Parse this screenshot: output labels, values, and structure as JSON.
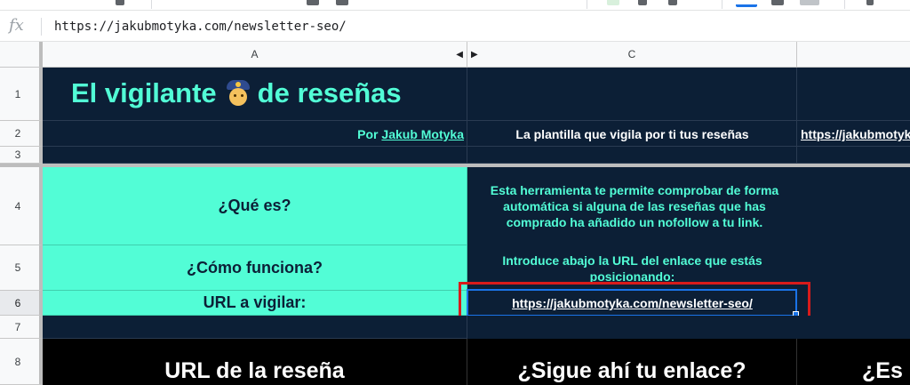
{
  "formula_bar": {
    "fx_label": "fx",
    "value": "https://jakubmotyka.com/newsletter-seo/"
  },
  "columns": {
    "a": "A",
    "c": "C"
  },
  "rows": [
    "1",
    "2",
    "3",
    "4",
    "5",
    "6",
    "7",
    "8"
  ],
  "sheet": {
    "title_left": "El vigilante",
    "title_right": "de reseñas",
    "emoji_icon": "police-officer-icon",
    "by_prefix": "Por",
    "by_author": "Jakub Motyka",
    "tagline": "La plantilla que vigila por ti tus reseñas",
    "row2_link": "https://jakubmotyka.com/newsletter-seo/",
    "q_what": "¿Qué es?",
    "q_how": "¿Cómo funciona?",
    "q_url": "URL a vigilar:",
    "desc_line1": "Esta herramienta te permite comprobar de forma",
    "desc_line2": "automática si alguna de las reseñas que has",
    "desc_line3": "comprado ha añadido un nofollow a tu link.",
    "how_line1": "Introduce abajo la URL del enlace que estás",
    "how_line2": "posicionando:",
    "url_value": "https://jakubmotyka.com/newsletter-seo/",
    "hdr_url": "URL de la reseña",
    "hdr_follow": "¿Sigue ahí tu enlace?",
    "hdr_es": "¿Es"
  },
  "colors": {
    "navy": "#0c1f36",
    "mint": "#52fdd6",
    "selection_blue": "#1a73e8",
    "highlight_red": "#d81b1b"
  }
}
